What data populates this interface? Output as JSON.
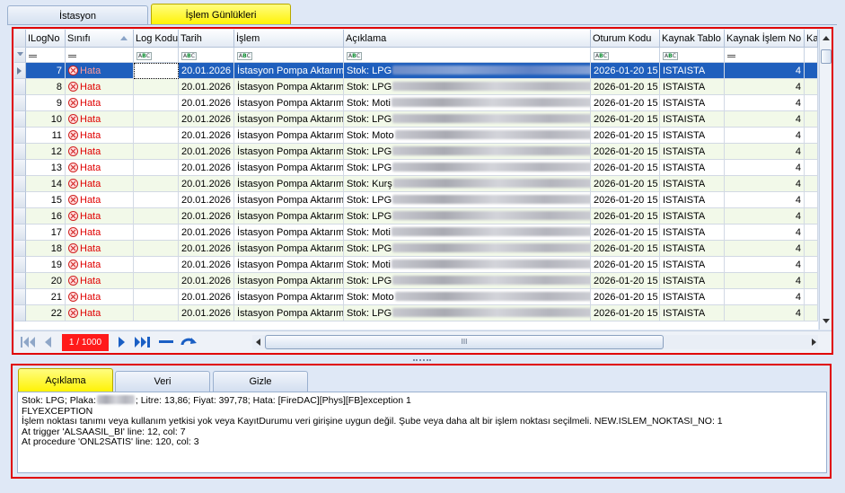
{
  "top_tabs": [
    {
      "label": "İstasyon"
    },
    {
      "label": "İşlem Günlükleri"
    }
  ],
  "grid": {
    "columns": [
      "ILogNo",
      "Sınıfı",
      "Log Kodu",
      "Tarih",
      "İşlem",
      "Açıklama",
      "Oturum Kodu",
      "Kaynak Tablo",
      "Kaynak İşlem No",
      "Ka"
    ],
    "filter_types": [
      "eq",
      "eq",
      "abc",
      "abc",
      "abc",
      "abc",
      "abc",
      "abc",
      "eq",
      ""
    ],
    "rows": [
      {
        "no": "7",
        "sinif": "Hata",
        "log": "",
        "tarih": "20.01.2026",
        "islem": "İstasyon Pompa Aktarımı",
        "aciklama": "Stok: LPG",
        "oturum": "2026-01-20 15",
        "tablo": "ISTAISTA",
        "kaynak": "4"
      },
      {
        "no": "8",
        "sinif": "Hata",
        "log": "",
        "tarih": "20.01.2026",
        "islem": "İstasyon Pompa Aktarımı",
        "aciklama": "Stok: LPG",
        "oturum": "2026-01-20 15",
        "tablo": "ISTAISTA",
        "kaynak": "4"
      },
      {
        "no": "9",
        "sinif": "Hata",
        "log": "",
        "tarih": "20.01.2026",
        "islem": "İstasyon Pompa Aktarımı",
        "aciklama": "Stok: Moti",
        "oturum": "2026-01-20 15",
        "tablo": "ISTAISTA",
        "kaynak": "4"
      },
      {
        "no": "10",
        "sinif": "Hata",
        "log": "",
        "tarih": "20.01.2026",
        "islem": "İstasyon Pompa Aktarımı",
        "aciklama": "Stok: LPG",
        "oturum": "2026-01-20 15",
        "tablo": "ISTAISTA",
        "kaynak": "4"
      },
      {
        "no": "11",
        "sinif": "Hata",
        "log": "",
        "tarih": "20.01.2026",
        "islem": "İstasyon Pompa Aktarımı",
        "aciklama": "Stok: Moto",
        "oturum": "2026-01-20 15",
        "tablo": "ISTAISTA",
        "kaynak": "4"
      },
      {
        "no": "12",
        "sinif": "Hata",
        "log": "",
        "tarih": "20.01.2026",
        "islem": "İstasyon Pompa Aktarımı",
        "aciklama": "Stok: LPG",
        "oturum": "2026-01-20 15",
        "tablo": "ISTAISTA",
        "kaynak": "4"
      },
      {
        "no": "13",
        "sinif": "Hata",
        "log": "",
        "tarih": "20.01.2026",
        "islem": "İstasyon Pompa Aktarımı",
        "aciklama": "Stok: LPG",
        "oturum": "2026-01-20 15",
        "tablo": "ISTAISTA",
        "kaynak": "4"
      },
      {
        "no": "14",
        "sinif": "Hata",
        "log": "",
        "tarih": "20.01.2026",
        "islem": "İstasyon Pompa Aktarımı",
        "aciklama": "Stok: Kurş",
        "oturum": "2026-01-20 15",
        "tablo": "ISTAISTA",
        "kaynak": "4"
      },
      {
        "no": "15",
        "sinif": "Hata",
        "log": "",
        "tarih": "20.01.2026",
        "islem": "İstasyon Pompa Aktarımı",
        "aciklama": "Stok: LPG",
        "oturum": "2026-01-20 15",
        "tablo": "ISTAISTA",
        "kaynak": "4"
      },
      {
        "no": "16",
        "sinif": "Hata",
        "log": "",
        "tarih": "20.01.2026",
        "islem": "İstasyon Pompa Aktarımı",
        "aciklama": "Stok: LPG",
        "oturum": "2026-01-20 15",
        "tablo": "ISTAISTA",
        "kaynak": "4"
      },
      {
        "no": "17",
        "sinif": "Hata",
        "log": "",
        "tarih": "20.01.2026",
        "islem": "İstasyon Pompa Aktarımı",
        "aciklama": "Stok: Moti",
        "oturum": "2026-01-20 15",
        "tablo": "ISTAISTA",
        "kaynak": "4"
      },
      {
        "no": "18",
        "sinif": "Hata",
        "log": "",
        "tarih": "20.01.2026",
        "islem": "İstasyon Pompa Aktarımı",
        "aciklama": "Stok: LPG",
        "oturum": "2026-01-20 15",
        "tablo": "ISTAISTA",
        "kaynak": "4"
      },
      {
        "no": "19",
        "sinif": "Hata",
        "log": "",
        "tarih": "20.01.2026",
        "islem": "İstasyon Pompa Aktarımı",
        "aciklama": "Stok: Moti",
        "oturum": "2026-01-20 15",
        "tablo": "ISTAISTA",
        "kaynak": "4"
      },
      {
        "no": "20",
        "sinif": "Hata",
        "log": "",
        "tarih": "20.01.2026",
        "islem": "İstasyon Pompa Aktarımı",
        "aciklama": "Stok: LPG",
        "oturum": "2026-01-20 15",
        "tablo": "ISTAISTA",
        "kaynak": "4"
      },
      {
        "no": "21",
        "sinif": "Hata",
        "log": "",
        "tarih": "20.01.2026",
        "islem": "İstasyon Pompa Aktarımı",
        "aciklama": "Stok: Moto",
        "oturum": "2026-01-20 15",
        "tablo": "ISTAISTA",
        "kaynak": "4"
      },
      {
        "no": "22",
        "sinif": "Hata",
        "log": "",
        "tarih": "20.01.2026",
        "islem": "İstasyon Pompa Aktarımı",
        "aciklama": "Stok: LPG",
        "oturum": "2026-01-20 15",
        "tablo": "ISTAISTA",
        "kaynak": "4"
      }
    ],
    "selected_row": 0
  },
  "navigator": {
    "page_label": "1 / 1000"
  },
  "detail": {
    "tabs": [
      {
        "label": "Açıklama"
      },
      {
        "label": "Veri"
      },
      {
        "label": "Gizle"
      }
    ],
    "lines": [
      "Stok: LPG; Plaka:",
      "; Litre: 13,86; Fiyat: 397,78; Hata: [FireDAC][Phys][FB]exception 1",
      "FLYEXCEPTION",
      "İşlem noktası tanımı veya kullanım yetkisi yok veya KayıtDurumu veri girişine uygun değil. Şube veya daha alt bir işlem noktası seçilmeli. NEW.ISLEM_NOKTASI_NO: 1",
      "At trigger 'ALSAASIL_BI' line: 12, col: 7",
      "At procedure 'ONL2SATIS' line: 120, col: 3"
    ]
  },
  "colors": {
    "selected_row": "#1f5fbd",
    "error_text": "#e00000",
    "active_tab": "#fff200",
    "highlight_frame": "#e00000"
  }
}
